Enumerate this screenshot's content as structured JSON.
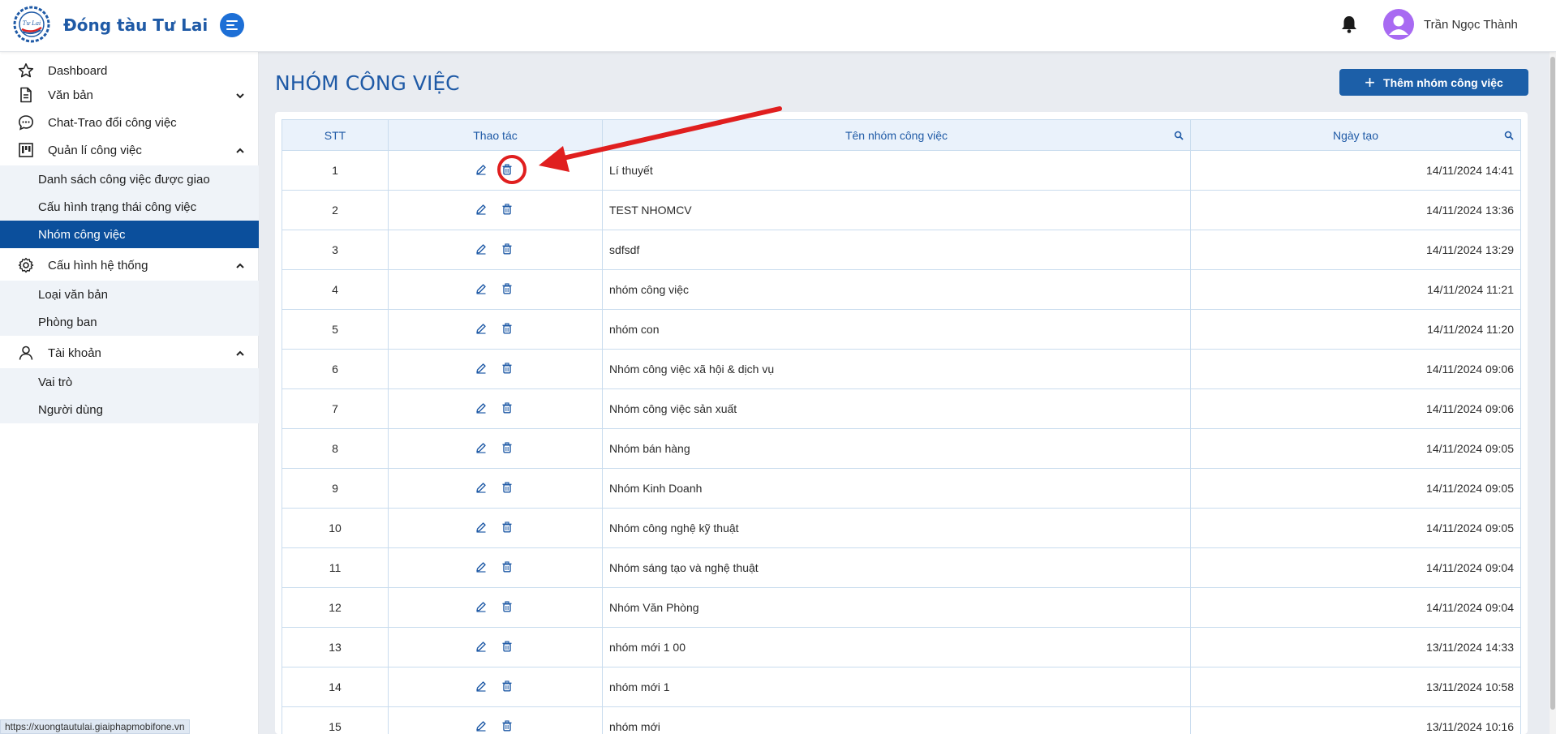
{
  "header": {
    "brand": "Đóng tàu Tư Lai",
    "user_name": "Trần Ngọc Thành",
    "logo_text": "Tư Lai shipyard"
  },
  "sidebar": {
    "dashboard": "Dashboard",
    "van_ban": "Văn bản",
    "chat": "Chat-Trao đổi công việc",
    "quan_li": "Quản lí công việc",
    "quan_li_sub": [
      "Danh sách công việc được giao",
      "Cấu hình trạng thái công việc",
      "Nhóm công việc"
    ],
    "cau_hinh": "Cấu hình hệ thống",
    "cau_hinh_sub": [
      "Loại văn bản",
      "Phòng ban"
    ],
    "tai_khoan": "Tài khoản",
    "tai_khoan_sub": [
      "Vai trò",
      "Người dùng"
    ]
  },
  "main": {
    "title": "NHÓM CÔNG VIỆC",
    "add_button": "Thêm nhóm công việc"
  },
  "table": {
    "headers": {
      "stt": "STT",
      "actions": "Thao tác",
      "name": "Tên nhóm công việc",
      "date": "Ngày tạo"
    },
    "rows": [
      {
        "stt": "1",
        "name": "Lí thuyết",
        "date": "14/11/2024 14:41"
      },
      {
        "stt": "2",
        "name": "TEST NHOMCV",
        "date": "14/11/2024 13:36"
      },
      {
        "stt": "3",
        "name": "sdfsdf",
        "date": "14/11/2024 13:29"
      },
      {
        "stt": "4",
        "name": "nhóm công việc",
        "date": "14/11/2024 11:21"
      },
      {
        "stt": "5",
        "name": "nhóm con",
        "date": "14/11/2024 11:20"
      },
      {
        "stt": "6",
        "name": "Nhóm công việc xã hội & dịch vụ",
        "date": "14/11/2024 09:06"
      },
      {
        "stt": "7",
        "name": "Nhóm công việc sản xuất",
        "date": "14/11/2024 09:06"
      },
      {
        "stt": "8",
        "name": "Nhóm bán hàng",
        "date": "14/11/2024 09:05"
      },
      {
        "stt": "9",
        "name": "Nhóm Kinh Doanh",
        "date": "14/11/2024 09:05"
      },
      {
        "stt": "10",
        "name": "Nhóm công nghệ kỹ thuật",
        "date": "14/11/2024 09:05"
      },
      {
        "stt": "11",
        "name": "Nhóm sáng tạo và nghệ thuật",
        "date": "14/11/2024 09:04"
      },
      {
        "stt": "12",
        "name": "Nhóm Văn Phòng",
        "date": "14/11/2024 09:04"
      },
      {
        "stt": "13",
        "name": "nhóm mới 1 00",
        "date": "13/11/2024 14:33"
      },
      {
        "stt": "14",
        "name": "nhóm mới 1",
        "date": "13/11/2024 10:58"
      },
      {
        "stt": "15",
        "name": "nhóm mới",
        "date": "13/11/2024 10:16"
      }
    ]
  },
  "status_url": "https://xuongtautulai.giaiphapmobifone.vn",
  "colors": {
    "brand": "#1f5aa6",
    "active_nav": "#0b4f9c",
    "button": "#1c5fa8",
    "annotation": "#e01f1f",
    "avatar": "#a86af2"
  }
}
